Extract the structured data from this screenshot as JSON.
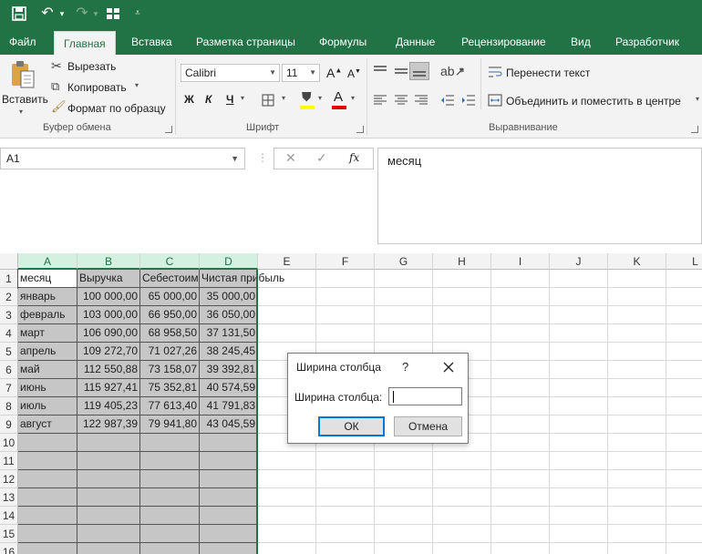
{
  "tabs": [
    "Файл",
    "Главная",
    "Вставка",
    "Разметка страницы",
    "Формулы",
    "Данные",
    "Рецензирование",
    "Вид",
    "Разработчик"
  ],
  "active_tab": "Главная",
  "clipboard": {
    "paste_label": "Вставить",
    "cut_label": "Вырезать",
    "copy_label": "Копировать",
    "format_painter_label": "Формат по образцу",
    "group_label": "Буфер обмена"
  },
  "font": {
    "name": "Calibri",
    "size": "11",
    "bold": "Ж",
    "italic": "К",
    "underline": "Ч",
    "grow": "A",
    "shrink": "A",
    "font_color_letter": "A",
    "group_label": "Шрифт"
  },
  "alignment": {
    "wrap_label": "Перенести текст",
    "merge_label": "Объединить и поместить в центре",
    "group_label": "Выравнивание"
  },
  "name_box": "A1",
  "formula_content": "месяц",
  "fx_symbol": "fx",
  "columns": [
    "A",
    "B",
    "C",
    "D",
    "E",
    "F",
    "G",
    "H",
    "I",
    "J",
    "K",
    "L"
  ],
  "rows": [
    "1",
    "2",
    "3",
    "4",
    "5",
    "6",
    "7",
    "8",
    "9",
    "10",
    "11",
    "12",
    "13",
    "14",
    "15",
    "16"
  ],
  "table": [
    [
      "месяц",
      "Выручка",
      "Себестоимость",
      "Чистая прибыль"
    ],
    [
      "январь",
      "100 000,00",
      "65 000,00",
      "35 000,00"
    ],
    [
      "февраль",
      "103 000,00",
      "66 950,00",
      "36 050,00"
    ],
    [
      "март",
      "106 090,00",
      "68 958,50",
      "37 131,50"
    ],
    [
      "апрель",
      "109 272,70",
      "71 027,26",
      "38 245,45"
    ],
    [
      "май",
      "112 550,88",
      "73 158,07",
      "39 392,81"
    ],
    [
      "июнь",
      "115 927,41",
      "75 352,81",
      "40 574,59"
    ],
    [
      "июль",
      "119 405,23",
      "77 613,40",
      "41 791,83"
    ],
    [
      "август",
      "122 987,39",
      "79 941,80",
      "43 045,59"
    ]
  ],
  "dialog": {
    "title": "Ширина столбца",
    "help": "?",
    "field_label": "Ширина столбца:",
    "field_value": "",
    "ok_label": "ОК",
    "cancel_label": "Отмена"
  },
  "colors": {
    "brand": "#217346",
    "selection_fill": "#c6c6c6",
    "selected_header": "#d3f0e0"
  }
}
